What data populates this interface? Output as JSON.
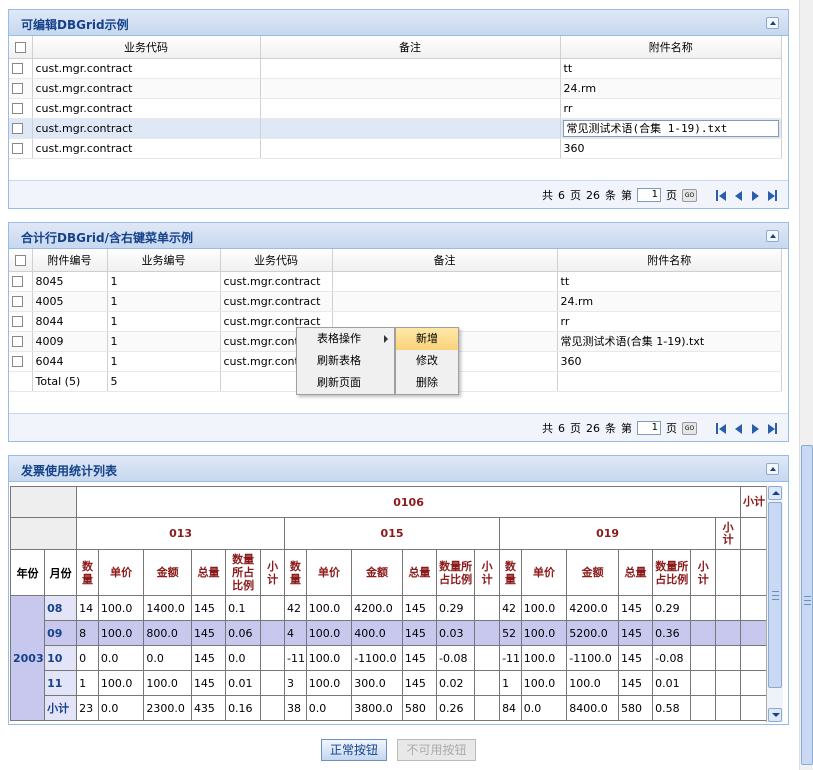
{
  "panel1": {
    "title": "可编辑DBGrid示例",
    "columns": [
      "业务代码",
      "备注",
      "附件名称"
    ],
    "rows": [
      {
        "code": "cust.mgr.contract",
        "note": "",
        "file": "tt"
      },
      {
        "code": "cust.mgr.contract",
        "note": "",
        "file": "24.rm"
      },
      {
        "code": "cust.mgr.contract",
        "note": "",
        "file": "rr"
      },
      {
        "code": "cust.mgr.contract",
        "note": "",
        "file": "常见测试术语(合集 1-19).txt"
      },
      {
        "code": "cust.mgr.contract",
        "note": "",
        "file": "360"
      }
    ],
    "pager": {
      "total_prefix": "共",
      "pages": "6",
      "pages_unit": "页",
      "count": "26",
      "count_unit": "条",
      "page_prefix": "第",
      "page_value": "1",
      "page_unit": "页",
      "go": "GO"
    }
  },
  "panel2": {
    "title": "合计行DBGrid/含右键菜单示例",
    "columns": [
      "附件编号",
      "业务编号",
      "业务代码",
      "备注",
      "附件名称"
    ],
    "rows": [
      {
        "id": "8045",
        "biz": "1",
        "code": "cust.mgr.contract",
        "note": "",
        "file": "tt"
      },
      {
        "id": "4005",
        "biz": "1",
        "code": "cust.mgr.contract",
        "note": "",
        "file": "24.rm"
      },
      {
        "id": "8044",
        "biz": "1",
        "code": "cust.mgr.contract",
        "note": "",
        "file": "rr"
      },
      {
        "id": "4009",
        "biz": "1",
        "code": "cust.mgr.cont",
        "note": "",
        "file": "常见测试术语(合集 1-19).txt"
      },
      {
        "id": "6044",
        "biz": "1",
        "code": "cust.mgr.cont",
        "note": "",
        "file": "360"
      }
    ],
    "total": {
      "label": "Total (5)",
      "value": "5"
    },
    "pager": {
      "total_prefix": "共",
      "pages": "6",
      "pages_unit": "页",
      "count": "26",
      "count_unit": "条",
      "page_prefix": "第",
      "page_value": "1",
      "page_unit": "页",
      "go": "GO"
    },
    "context_menu": {
      "items": [
        "表格操作",
        "刷新表格",
        "刷新页面"
      ],
      "submenu": [
        "新增",
        "修改",
        "删除"
      ]
    }
  },
  "panel3": {
    "title": "发票使用统计列表",
    "top_group": "0106",
    "subtotal": "小计",
    "groups": [
      "013",
      "015",
      "019"
    ],
    "row_headers": [
      "年份",
      "月份"
    ],
    "metric_cols": [
      "数量",
      "单价",
      "金额",
      "总量",
      "数量所占比例",
      "小计"
    ],
    "year": "2003",
    "rows": [
      {
        "month": "08",
        "g1": [
          "14",
          "100.0",
          "1400.0",
          "145",
          "0.1"
        ],
        "g2": [
          "42",
          "100.0",
          "4200.0",
          "145",
          "0.29"
        ],
        "g3": [
          "42",
          "100.0",
          "4200.0",
          "145",
          "0.29"
        ]
      },
      {
        "month": "09",
        "g1": [
          "8",
          "100.0",
          "800.0",
          "145",
          "0.06"
        ],
        "g2": [
          "4",
          "100.0",
          "400.0",
          "145",
          "0.03"
        ],
        "g3": [
          "52",
          "100.0",
          "5200.0",
          "145",
          "0.36"
        ]
      },
      {
        "month": "10",
        "g1": [
          "0",
          "0.0",
          "0.0",
          "145",
          "0.0"
        ],
        "g2": [
          "-11",
          "100.0",
          "-1100.0",
          "145",
          "-0.08"
        ],
        "g3": [
          "-11",
          "100.0",
          "-1100.0",
          "145",
          "-0.08"
        ]
      },
      {
        "month": "11",
        "g1": [
          "1",
          "100.0",
          "100.0",
          "145",
          "0.01"
        ],
        "g2": [
          "3",
          "100.0",
          "300.0",
          "145",
          "0.02"
        ],
        "g3": [
          "1",
          "100.0",
          "100.0",
          "145",
          "0.01"
        ]
      },
      {
        "month": "小计",
        "g1": [
          "23",
          "0.0",
          "2300.0",
          "435",
          "0.16"
        ],
        "g2": [
          "38",
          "0.0",
          "3800.0",
          "580",
          "0.26"
        ],
        "g3": [
          "84",
          "0.0",
          "8400.0",
          "580",
          "0.58"
        ]
      }
    ]
  },
  "buttons": {
    "normal": "正常按钮",
    "disabled": "不可用按钮"
  },
  "colors": {
    "panel_header": "#c7d8ef",
    "title_text": "#15428b",
    "stat_header_text": "#8b1a1a",
    "row_highlight": "#c8c8ef"
  }
}
